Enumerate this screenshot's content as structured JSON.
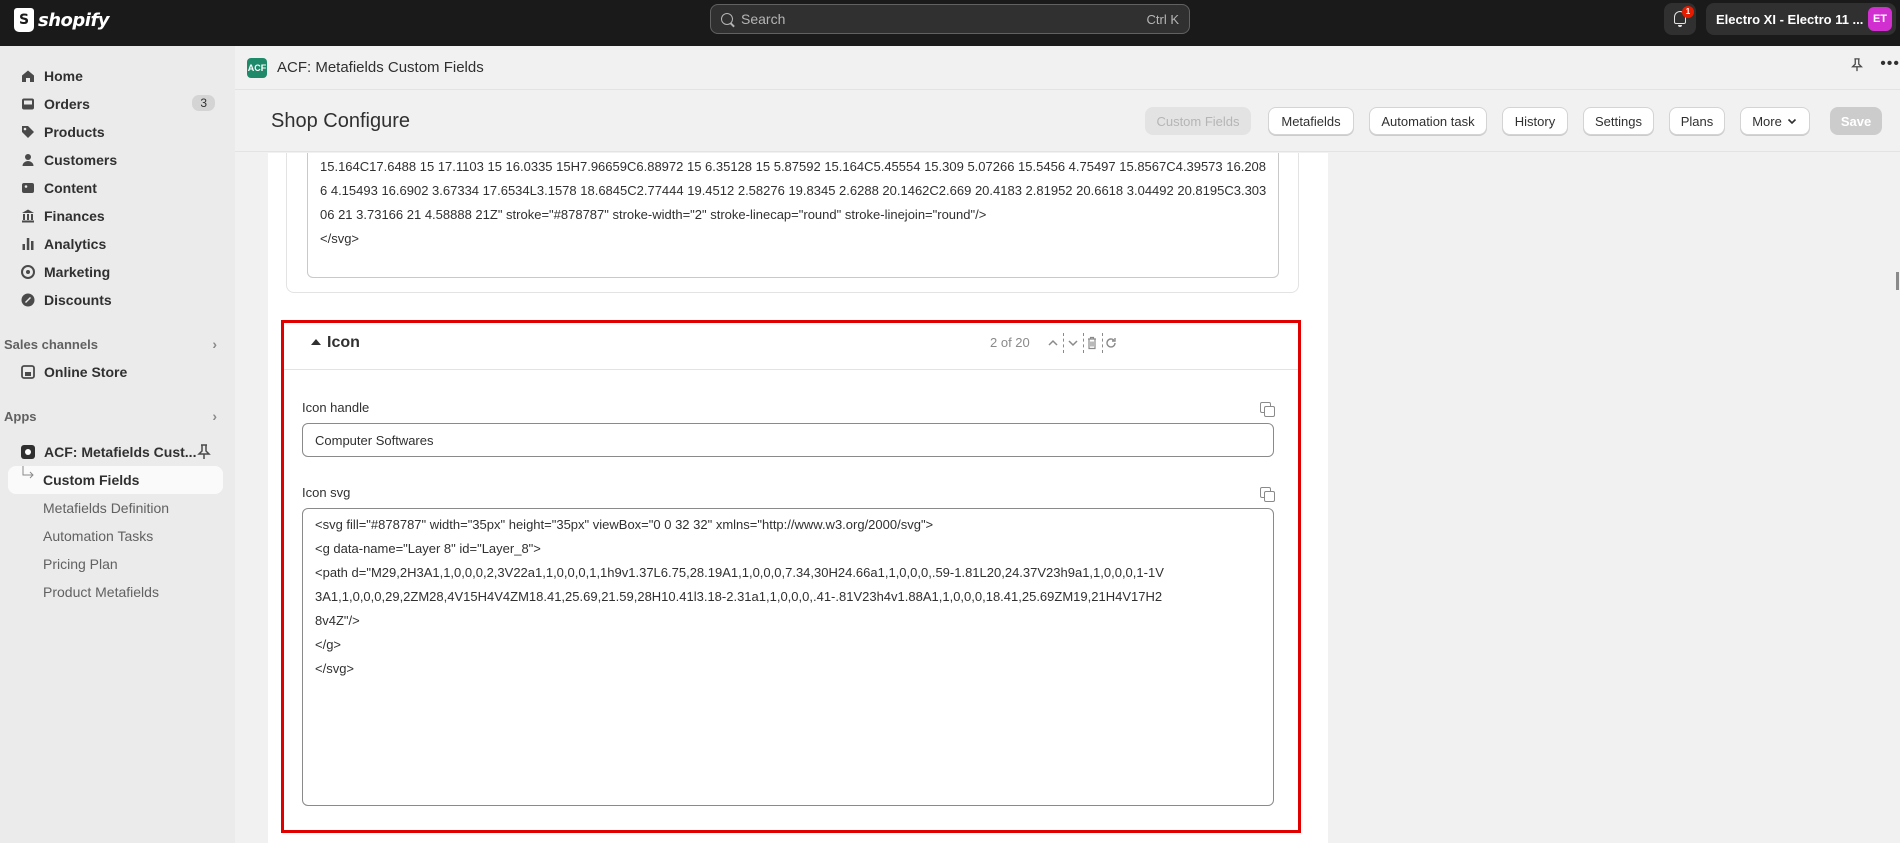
{
  "topbar": {
    "brand": "shopify",
    "search_placeholder": "Search",
    "search_shortcut": "Ctrl K",
    "notification_count": "1",
    "store_name": "Electro XI - Electro 11 ...",
    "avatar_initials": "ET"
  },
  "sidebar": {
    "items": [
      {
        "label": "Home",
        "icon": "home-icon"
      },
      {
        "label": "Orders",
        "icon": "inbox-icon",
        "badge": "3"
      },
      {
        "label": "Products",
        "icon": "tag-icon"
      },
      {
        "label": "Customers",
        "icon": "person-icon"
      },
      {
        "label": "Content",
        "icon": "image-icon"
      },
      {
        "label": "Finances",
        "icon": "bank-icon"
      },
      {
        "label": "Analytics",
        "icon": "bar-chart-icon"
      },
      {
        "label": "Marketing",
        "icon": "target-icon"
      },
      {
        "label": "Discounts",
        "icon": "discount-icon"
      }
    ],
    "sales_channels_label": "Sales channels",
    "online_store_label": "Online Store",
    "apps_label": "Apps",
    "app_name": "ACF: Metafields Cust...",
    "app_subitems": [
      "Custom Fields",
      "Metafields Definition",
      "Automation Tasks",
      "Pricing Plan",
      "Product Metafields"
    ]
  },
  "app_bar": {
    "icon_text": "ACF",
    "title": "ACF: Metafields Custom Fields"
  },
  "header": {
    "title": "Shop Configure",
    "buttons": {
      "custom_fields": "Custom Fields",
      "metafields": "Metafields",
      "automation_task": "Automation task",
      "history": "History",
      "settings": "Settings",
      "plans": "Plans",
      "more": "More",
      "save": "Save"
    }
  },
  "previous_entry": {
    "svg_tail": "15.164C17.6488 15 17.1103 15 16.0335 15H7.96659C6.88972 15 6.35128 15 5.87592 15.164C5.45554 15.309 5.07266 15.5456 4.75497 15.8567C4.39573 16.2086 4.15493 16.6902 3.67334 17.6534L3.1578 18.6845C2.77444 19.4512 2.58276 19.8345 2.6288 20.1462C2.669 20.4183 2.81952 20.6618 3.04492 20.8195C3.30306 21 3.73166 21 4.58888 21Z\" stroke=\"#878787\" stroke-width=\"2\" stroke-linecap=\"round\" stroke-linejoin=\"round\"/>\n</svg>"
  },
  "icon_entry": {
    "title": "Icon",
    "pager": "2 of 20",
    "handle_label": "Icon handle",
    "handle_value": "Computer Softwares",
    "svg_label": "Icon svg",
    "svg_value": "<svg fill=\"#878787\" width=\"35px\" height=\"35px\" viewBox=\"0 0 32 32\" xmlns=\"http://www.w3.org/2000/svg\">\n<g data-name=\"Layer 8\" id=\"Layer_8\">\n<path d=\"M29,2H3A1,1,0,0,0,2,3V22a1,1,0,0,0,1,1h9v1.37L6.75,28.19A1,1,0,0,0,7.34,30H24.66a1,1,0,0,0,.59-1.81L20,24.37V23h9a1,1,0,0,0,1-1V3A1,1,0,0,0,29,2ZM28,4V15H4V4ZM18.41,25.69,21.59,28H10.41l3.18-2.31a1,1,0,0,0,.41-.81V23h4v1.88A1,1,0,0,0,18.41,25.69ZM19,21H4V17H28v4Z\"/>\n</g>\n</svg>"
  },
  "colors": {
    "topbar_bg": "#1a1a1a",
    "highlight_border": "#e00000",
    "avatar_bg": "#d12fd0",
    "app_icon_bg": "#1e8a6a"
  }
}
